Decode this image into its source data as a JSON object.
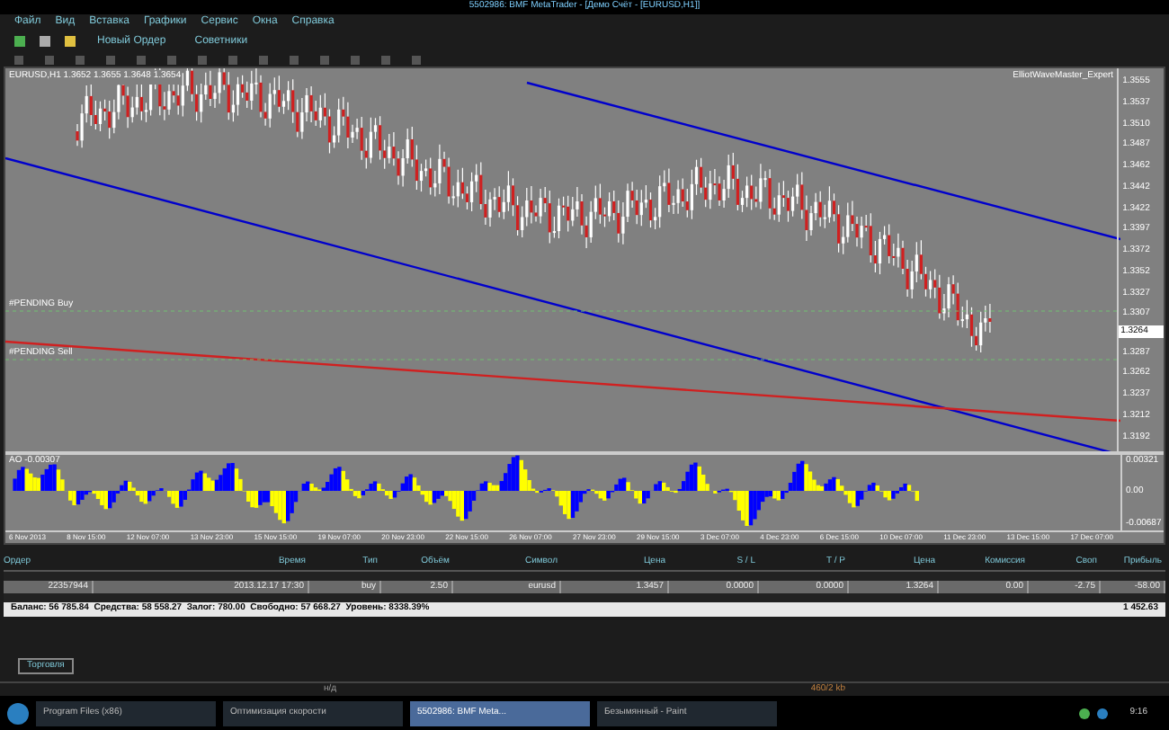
{
  "window": {
    "title": "5502986: BMF MetaTrader - [Демо Счёт - [EURUSD,H1]]"
  },
  "menu": [
    "Файл",
    "Вид",
    "Вставка",
    "Графики",
    "Сервис",
    "Окна",
    "Справка"
  ],
  "toolbar": {
    "buttons": [
      {
        "label": "Новый Ордер"
      },
      {
        "label": "Советники"
      }
    ]
  },
  "chart": {
    "header": "EURUSD,H1 1.3652 1.3655 1.3648 1.3654",
    "expert": "ElliotWaveMaster_Expert",
    "line_labels": [
      "#PENDING Buy",
      "#PENDING Sell"
    ],
    "price_axis": [
      "1.3555",
      "1.3537",
      "1.3510",
      "1.3487",
      "1.3462",
      "1.3442",
      "1.3422",
      "1.3397",
      "1.3372",
      "1.3352",
      "1.3327",
      "1.3307",
      "1.3287",
      "1.3262",
      "1.3237",
      "1.3212",
      "1.3192"
    ],
    "current_price": "1.3264",
    "indicator": {
      "label": "AO -0.00307",
      "axis": [
        "0.00321",
        "0.00",
        "-0.00687"
      ]
    },
    "time_axis": [
      "6 Nov 2013",
      "8 Nov 15:00",
      "12 Nov 07:00",
      "13 Nov 23:00",
      "15 Nov 15:00",
      "19 Nov 07:00",
      "20 Nov 23:00",
      "22 Nov 15:00",
      "26 Nov 07:00",
      "27 Nov 23:00",
      "29 Nov 15:00",
      "3 Dec 07:00",
      "4 Dec 23:00",
      "6 Dec 15:00",
      "10 Dec 07:00",
      "11 Dec 23:00",
      "13 Dec 15:00",
      "17 Dec 07:00"
    ]
  },
  "terminal": {
    "columns": [
      "Ордер",
      "Время",
      "Тип",
      "Объём",
      "Символ",
      "Цена",
      "S / L",
      "T / P",
      "Цена",
      "Комиссия",
      "Своп",
      "Прибыль"
    ],
    "rows": [
      {
        "selected": true,
        "cells": [
          "22357944",
          "2013.12.17 17:30",
          "buy",
          "2.50",
          "eurusd",
          "1.3457",
          "0.0000",
          "0.0000",
          "1.3264",
          "0.00",
          "-2.75",
          "-58.00"
        ]
      }
    ],
    "summary": "Баланс: 56 785.84  Средства: 58 558.27  Залог: 780.00  Свободно: 57 668.27  Уровень: 8338.39%",
    "total": "1 452.63",
    "tabs": [
      {
        "label": "Торговля",
        "selected": true
      }
    ]
  },
  "status": {
    "left": "н/д",
    "right": "460/2 kb"
  },
  "taskbar": {
    "items": [
      {
        "label": "Program Files (x86)",
        "selected": false
      },
      {
        "label": "Оптимизация скорости",
        "selected": false
      },
      {
        "label": "5502986: BMF Meta...",
        "selected": true
      },
      {
        "label": "Безымянный - Paint",
        "selected": false
      }
    ],
    "clock": "9:16"
  }
}
